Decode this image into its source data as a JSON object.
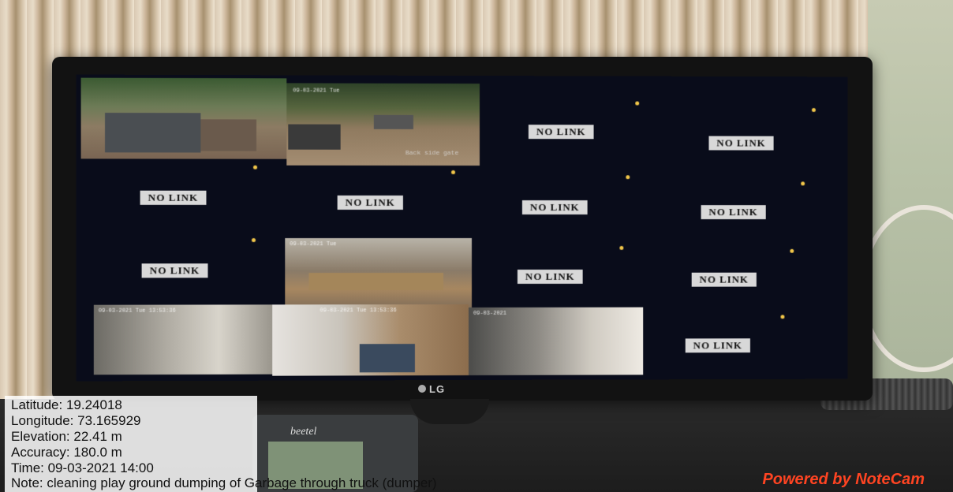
{
  "screen": {
    "no_link_label": "NO LINK",
    "cam_gate_label": "Back side gate"
  },
  "brand": "LG",
  "phone_brand": "beetel",
  "overlay": {
    "latitude": "Latitude: 19.24018",
    "longitude": "Longitude: 73.165929",
    "elevation": "Elevation: 22.41 m",
    "accuracy": "Accuracy: 180.0 m",
    "time": "Time: 09-03-2021 14:00",
    "note": "Note: cleaning play ground dumping of Garbage through truck (dumper)",
    "powered_by": "Powered by NoteCam"
  },
  "colors": {
    "screen_bg": "#090c1a",
    "label_bg": "#d8d8d8",
    "watermark": "#ff4422"
  }
}
